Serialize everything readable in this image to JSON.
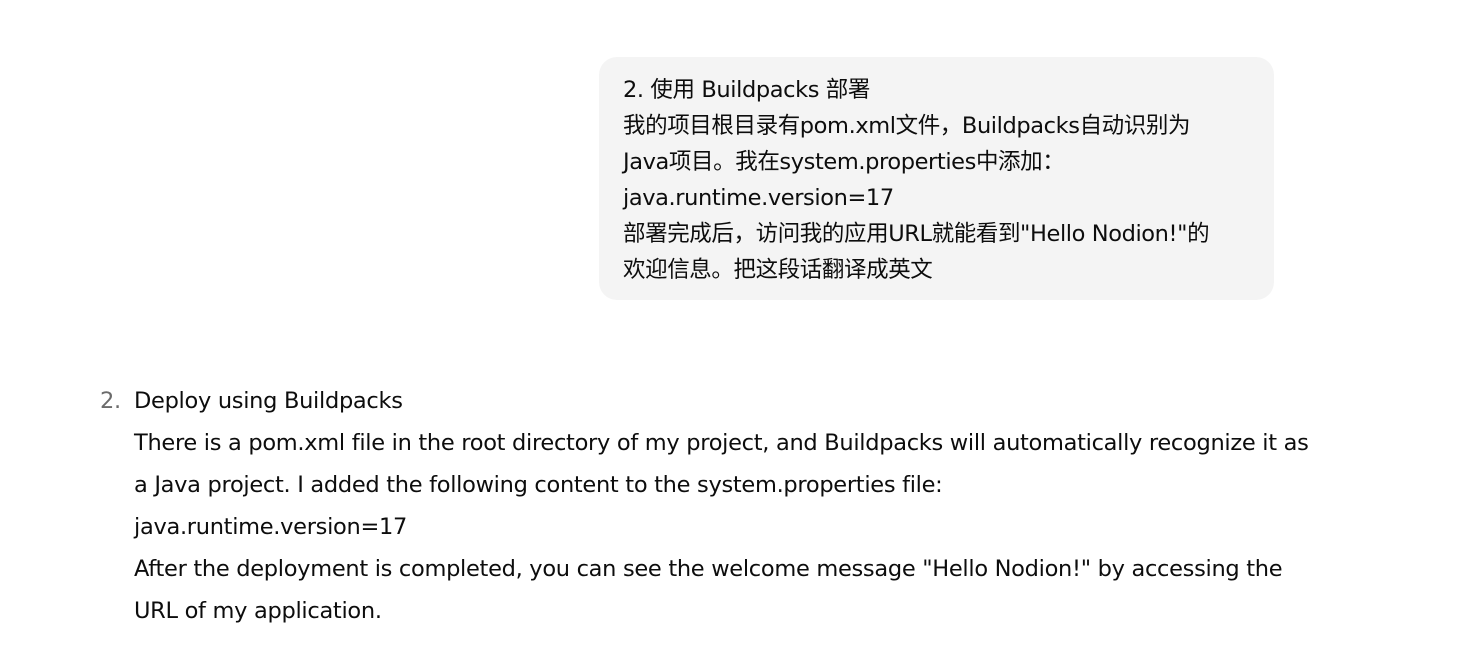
{
  "user_message": {
    "lines": [
      "2. 使用 Buildpacks 部署",
      "我的项目根目录有pom.xml文件，Buildpacks自动识别为",
      "Java项目。我在system.properties中添加：",
      "java.runtime.version=17",
      "部署完成后，访问我的应用URL就能看到\"Hello Nodion!\"的",
      "欢迎信息。把这段话翻译成英文"
    ]
  },
  "assistant_message": {
    "marker": "2.",
    "lines": [
      "Deploy using Buildpacks",
      "There is a pom.xml file in the root directory of my project, and Buildpacks will automatically recognize it as",
      "a Java project. I added the following content to the system.properties file:",
      "java.runtime.version=17",
      "After the deployment is completed, you can see the welcome message \"Hello Nodion!\" by accessing the",
      "URL of my application."
    ]
  }
}
